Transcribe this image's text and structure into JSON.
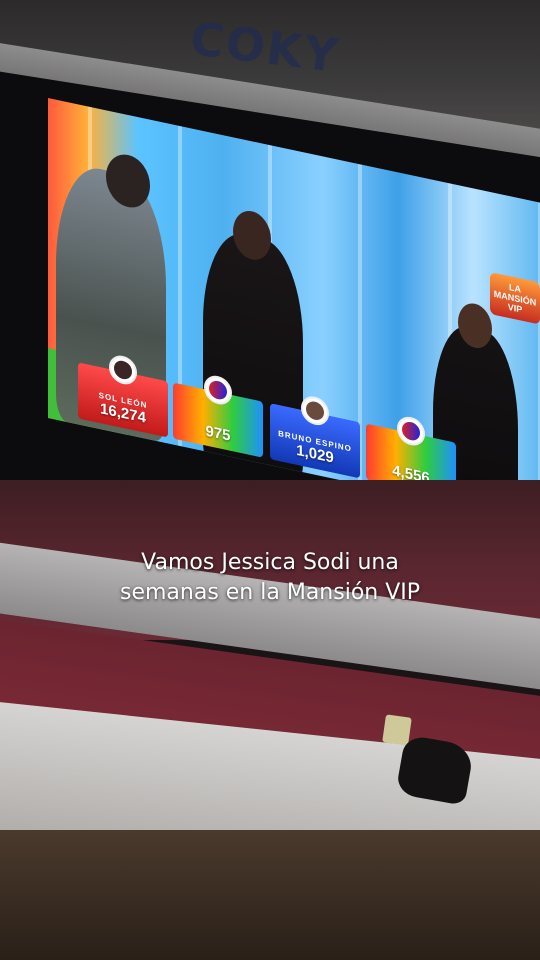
{
  "tv": {
    "logo_text": "LA MANSIÓN VIP",
    "votes": [
      {
        "name": "SOL LEÓN",
        "value": "16,274",
        "style": "red"
      },
      {
        "name": "",
        "value": "975",
        "style": "rainbow"
      },
      {
        "name": "BRUNO ESPINO",
        "value": "1,029",
        "style": "blue"
      },
      {
        "name": "",
        "value": "4,556",
        "style": "rainbow"
      }
    ]
  },
  "caption": {
    "line1": "Vamos Jessica Sodi una",
    "line2": "semanas en la Mansión VIP"
  },
  "decor": {
    "wall_letters": "COKY"
  }
}
